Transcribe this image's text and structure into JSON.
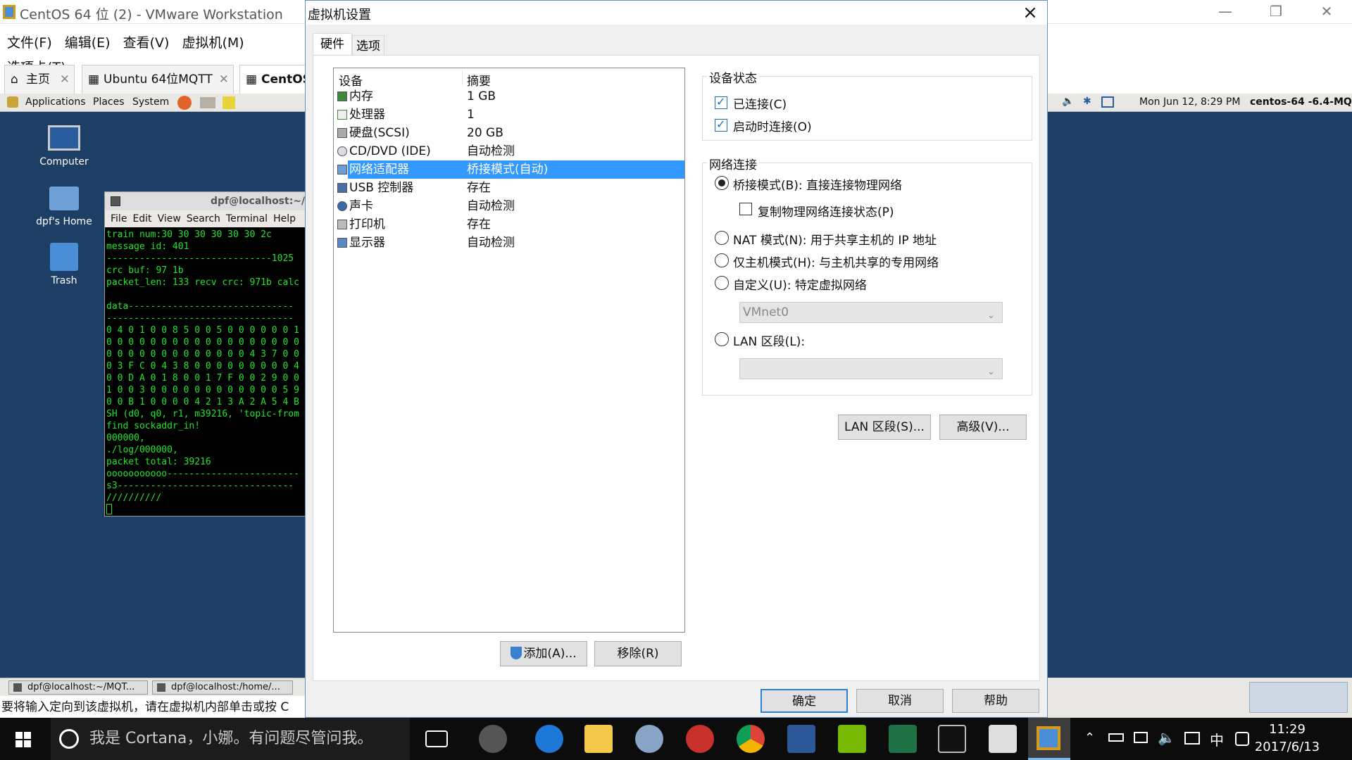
{
  "vmware": {
    "title": "CentOS 64 位 (2) - VMware Workstation",
    "menu": [
      "文件(F)",
      "编辑(E)",
      "查看(V)",
      "虚拟机(M)",
      "选项卡(T)"
    ],
    "tabs": [
      {
        "label": "主页"
      },
      {
        "label": "Ubuntu 64位MQTT"
      },
      {
        "label": "CentOS"
      }
    ],
    "status": "要将输入定向到该虚拟机，请在虚拟机内部单击或按 C"
  },
  "guest": {
    "top_menu": [
      "Applications",
      "Places",
      "System"
    ],
    "clock": "Mon Jun 12,  8:29 PM",
    "hostname": "centos-64 -6.4-MQ",
    "desktop_icons": [
      "Computer",
      "dpf's Home",
      "Trash"
    ],
    "terminal": {
      "title": "dpf@localhost:~/I",
      "menu": [
        "File",
        "Edit",
        "View",
        "Search",
        "Terminal",
        "Help"
      ],
      "lines": [
        "train num:30 30 30 30 30 30 2c",
        "message id: 401",
        "------------------------------1025",
        "crc buf: 97 1b",
        "packet_len: 133 recv crc: 971b calc",
        "",
        "data------------------------------",
        "----------------------------------",
        "0 4 0 1 0 0 8 5 0 0 5 0 0 0 0 0 0 1",
        "0 0 0 0 0 0 0 0 0 0 0 0 0 0 0 0 0 0",
        "0 0 0 0 0 0 0 0 0 0 0 0 0 4 3 7 0 0",
        "0 3 F C 0 4 3 8 0 0 0 0 0 0 0 0 0 4",
        "0 0 D A 0 1 8 0 0 1 7 F 0 0 2 9 0 0",
        "1 0 0 3 0 0 0 0 0 0 0 0 0 0 0 0 5 9",
        "0 0 B 1 0 0 0 0 4 2 1 3 A 2 A 5 4 B",
        "SH (d0, q0, r1, m39216, 'topic-from",
        "find sockaddr_in!",
        "000000,",
        "./log/000000,",
        "packet total: 39216",
        "ooooooooooo------------------------",
        "s3--------------------------------",
        "//////////"
      ]
    },
    "taskbar": [
      "dpf@localhost:~/MQT...",
      "dpf@localhost:/home/..."
    ]
  },
  "dialog": {
    "title": "虚拟机设置",
    "tabs": [
      "硬件",
      "选项"
    ],
    "columns": {
      "device": "设备",
      "summary": "摘要"
    },
    "devices": [
      {
        "name": "内存",
        "summary": "1 GB"
      },
      {
        "name": "处理器",
        "summary": "1"
      },
      {
        "name": "硬盘(SCSI)",
        "summary": "20 GB"
      },
      {
        "name": "CD/DVD (IDE)",
        "summary": "自动检测"
      },
      {
        "name": "网络适配器",
        "summary": "桥接模式(自动)"
      },
      {
        "name": "USB 控制器",
        "summary": "存在"
      },
      {
        "name": "声卡",
        "summary": "自动检测"
      },
      {
        "name": "打印机",
        "summary": "存在"
      },
      {
        "name": "显示器",
        "summary": "自动检测"
      }
    ],
    "add_button": "添加(A)...",
    "remove_button": "移除(R)",
    "device_status": {
      "title": "设备状态",
      "connected": "已连接(C)",
      "connect_at_power_on": "启动时连接(O)"
    },
    "network": {
      "title": "网络连接",
      "bridged": "桥接模式(B): 直接连接物理网络",
      "replicate": "复制物理网络连接状态(P)",
      "nat": "NAT 模式(N): 用于共享主机的 IP 地址",
      "host_only": "仅主机模式(H): 与主机共享的专用网络",
      "custom": "自定义(U): 特定虚拟网络",
      "custom_value": "VMnet0",
      "lan": "LAN 区段(L):",
      "lan_value": ""
    },
    "lan_segments_button": "LAN 区段(S)...",
    "advanced_button": "高级(V)...",
    "ok": "确定",
    "cancel": "取消",
    "help": "帮助"
  },
  "taskbar": {
    "cortana": "我是 Cortana，小娜。有问题尽管问我。",
    "time": "11:29",
    "date": "2017/6/13",
    "ime": "中"
  }
}
